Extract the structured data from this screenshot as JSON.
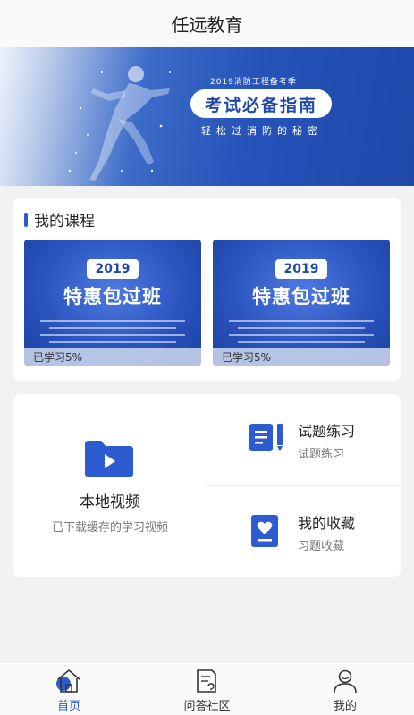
{
  "header": {
    "title": "任远教育"
  },
  "banner": {
    "subtitle": "2019消防工程备考季",
    "headline": "考试必备指南",
    "tagline": "轻松过消防的秘密"
  },
  "courses": {
    "section_title": "我的课程",
    "items": [
      {
        "year": "2019",
        "name": "特惠包过班",
        "progress_text": "已学习5%",
        "progress": 0.05
      },
      {
        "year": "2019",
        "name": "特惠包过班",
        "progress_text": "已学习5%",
        "progress": 0.05
      }
    ]
  },
  "features": {
    "local_video": {
      "title": "本地视频",
      "desc": "已下载缓存的学习视频",
      "icon": "video-folder-icon"
    },
    "practice": {
      "title": "试题练习",
      "desc": "试题练习",
      "icon": "notepad-pen-icon"
    },
    "favorites": {
      "title": "我的收藏",
      "desc": "习题收藏",
      "icon": "heart-doc-icon"
    }
  },
  "tabbar": {
    "active": "home",
    "items": [
      {
        "key": "home",
        "label": "首页",
        "icon": "home-icon"
      },
      {
        "key": "qa",
        "label": "问答社区",
        "icon": "qa-doc-icon"
      },
      {
        "key": "mine",
        "label": "我的",
        "icon": "user-icon"
      }
    ]
  },
  "colors": {
    "accent": "#2d5bd0",
    "banner_blue": "#1f49ab"
  }
}
